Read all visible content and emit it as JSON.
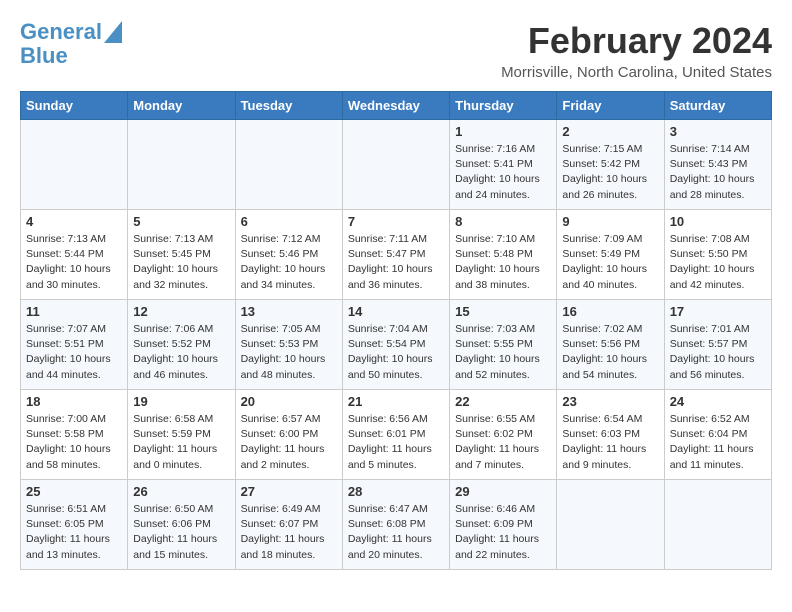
{
  "header": {
    "logo_line1": "General",
    "logo_line2": "Blue",
    "month": "February 2024",
    "location": "Morrisville, North Carolina, United States"
  },
  "days_of_week": [
    "Sunday",
    "Monday",
    "Tuesday",
    "Wednesday",
    "Thursday",
    "Friday",
    "Saturday"
  ],
  "weeks": [
    [
      {
        "day": "",
        "info": ""
      },
      {
        "day": "",
        "info": ""
      },
      {
        "day": "",
        "info": ""
      },
      {
        "day": "",
        "info": ""
      },
      {
        "day": "1",
        "info": "Sunrise: 7:16 AM\nSunset: 5:41 PM\nDaylight: 10 hours\nand 24 minutes."
      },
      {
        "day": "2",
        "info": "Sunrise: 7:15 AM\nSunset: 5:42 PM\nDaylight: 10 hours\nand 26 minutes."
      },
      {
        "day": "3",
        "info": "Sunrise: 7:14 AM\nSunset: 5:43 PM\nDaylight: 10 hours\nand 28 minutes."
      }
    ],
    [
      {
        "day": "4",
        "info": "Sunrise: 7:13 AM\nSunset: 5:44 PM\nDaylight: 10 hours\nand 30 minutes."
      },
      {
        "day": "5",
        "info": "Sunrise: 7:13 AM\nSunset: 5:45 PM\nDaylight: 10 hours\nand 32 minutes."
      },
      {
        "day": "6",
        "info": "Sunrise: 7:12 AM\nSunset: 5:46 PM\nDaylight: 10 hours\nand 34 minutes."
      },
      {
        "day": "7",
        "info": "Sunrise: 7:11 AM\nSunset: 5:47 PM\nDaylight: 10 hours\nand 36 minutes."
      },
      {
        "day": "8",
        "info": "Sunrise: 7:10 AM\nSunset: 5:48 PM\nDaylight: 10 hours\nand 38 minutes."
      },
      {
        "day": "9",
        "info": "Sunrise: 7:09 AM\nSunset: 5:49 PM\nDaylight: 10 hours\nand 40 minutes."
      },
      {
        "day": "10",
        "info": "Sunrise: 7:08 AM\nSunset: 5:50 PM\nDaylight: 10 hours\nand 42 minutes."
      }
    ],
    [
      {
        "day": "11",
        "info": "Sunrise: 7:07 AM\nSunset: 5:51 PM\nDaylight: 10 hours\nand 44 minutes."
      },
      {
        "day": "12",
        "info": "Sunrise: 7:06 AM\nSunset: 5:52 PM\nDaylight: 10 hours\nand 46 minutes."
      },
      {
        "day": "13",
        "info": "Sunrise: 7:05 AM\nSunset: 5:53 PM\nDaylight: 10 hours\nand 48 minutes."
      },
      {
        "day": "14",
        "info": "Sunrise: 7:04 AM\nSunset: 5:54 PM\nDaylight: 10 hours\nand 50 minutes."
      },
      {
        "day": "15",
        "info": "Sunrise: 7:03 AM\nSunset: 5:55 PM\nDaylight: 10 hours\nand 52 minutes."
      },
      {
        "day": "16",
        "info": "Sunrise: 7:02 AM\nSunset: 5:56 PM\nDaylight: 10 hours\nand 54 minutes."
      },
      {
        "day": "17",
        "info": "Sunrise: 7:01 AM\nSunset: 5:57 PM\nDaylight: 10 hours\nand 56 minutes."
      }
    ],
    [
      {
        "day": "18",
        "info": "Sunrise: 7:00 AM\nSunset: 5:58 PM\nDaylight: 10 hours\nand 58 minutes."
      },
      {
        "day": "19",
        "info": "Sunrise: 6:58 AM\nSunset: 5:59 PM\nDaylight: 11 hours\nand 0 minutes."
      },
      {
        "day": "20",
        "info": "Sunrise: 6:57 AM\nSunset: 6:00 PM\nDaylight: 11 hours\nand 2 minutes."
      },
      {
        "day": "21",
        "info": "Sunrise: 6:56 AM\nSunset: 6:01 PM\nDaylight: 11 hours\nand 5 minutes."
      },
      {
        "day": "22",
        "info": "Sunrise: 6:55 AM\nSunset: 6:02 PM\nDaylight: 11 hours\nand 7 minutes."
      },
      {
        "day": "23",
        "info": "Sunrise: 6:54 AM\nSunset: 6:03 PM\nDaylight: 11 hours\nand 9 minutes."
      },
      {
        "day": "24",
        "info": "Sunrise: 6:52 AM\nSunset: 6:04 PM\nDaylight: 11 hours\nand 11 minutes."
      }
    ],
    [
      {
        "day": "25",
        "info": "Sunrise: 6:51 AM\nSunset: 6:05 PM\nDaylight: 11 hours\nand 13 minutes."
      },
      {
        "day": "26",
        "info": "Sunrise: 6:50 AM\nSunset: 6:06 PM\nDaylight: 11 hours\nand 15 minutes."
      },
      {
        "day": "27",
        "info": "Sunrise: 6:49 AM\nSunset: 6:07 PM\nDaylight: 11 hours\nand 18 minutes."
      },
      {
        "day": "28",
        "info": "Sunrise: 6:47 AM\nSunset: 6:08 PM\nDaylight: 11 hours\nand 20 minutes."
      },
      {
        "day": "29",
        "info": "Sunrise: 6:46 AM\nSunset: 6:09 PM\nDaylight: 11 hours\nand 22 minutes."
      },
      {
        "day": "",
        "info": ""
      },
      {
        "day": "",
        "info": ""
      }
    ]
  ]
}
